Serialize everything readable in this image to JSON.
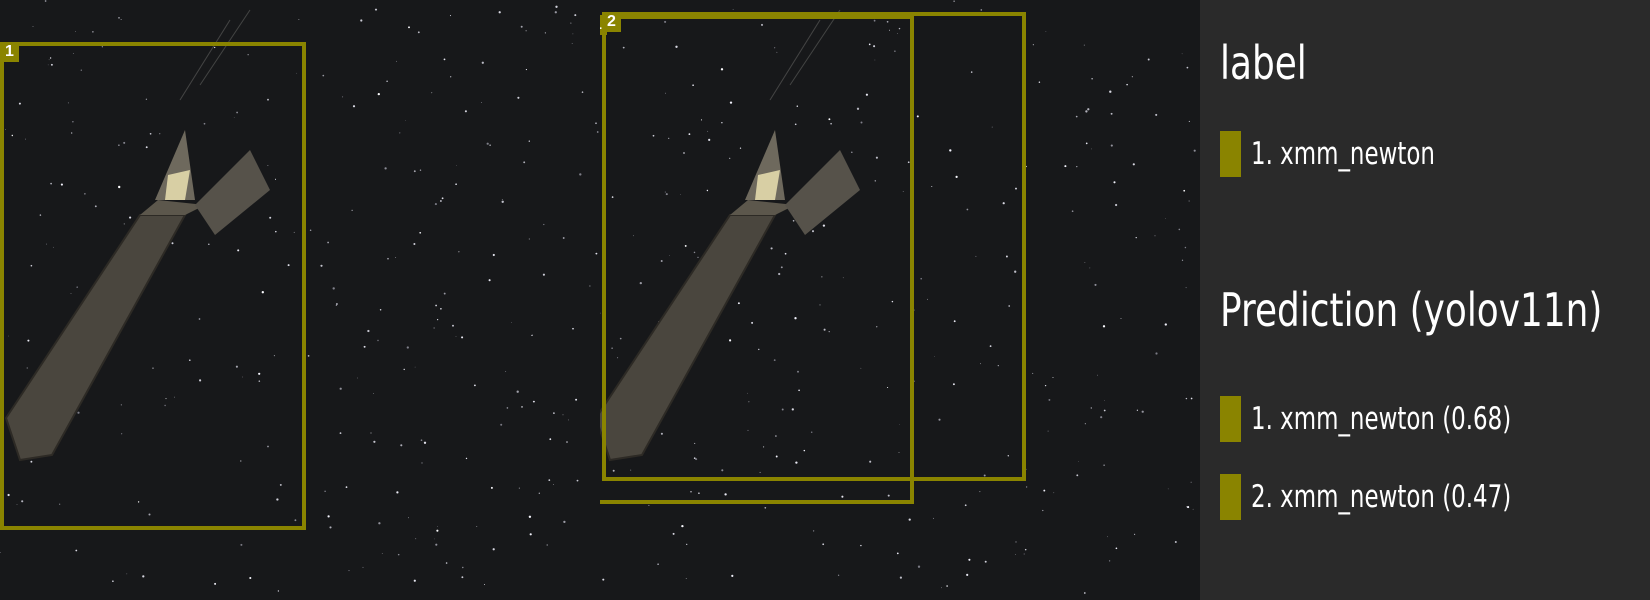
{
  "colors": {
    "box": "#8a8400",
    "background_left": "#17181a",
    "legend_bg": "#2a2a2a",
    "text": "#ffffff"
  },
  "panels": {
    "ground_truth": {
      "boxes": [
        {
          "id": "1"
        }
      ]
    },
    "prediction": {
      "boxes": [
        {
          "id": "1"
        },
        {
          "id": "2"
        }
      ]
    }
  },
  "legend": {
    "label_title": "label",
    "label_items": [
      {
        "text": "1. xmm_newton"
      }
    ],
    "prediction_title": "Prediction (yolov11n)",
    "prediction_items": [
      {
        "text": "1. xmm_newton (0.68)"
      },
      {
        "text": "2. xmm_newton (0.47)"
      }
    ]
  }
}
